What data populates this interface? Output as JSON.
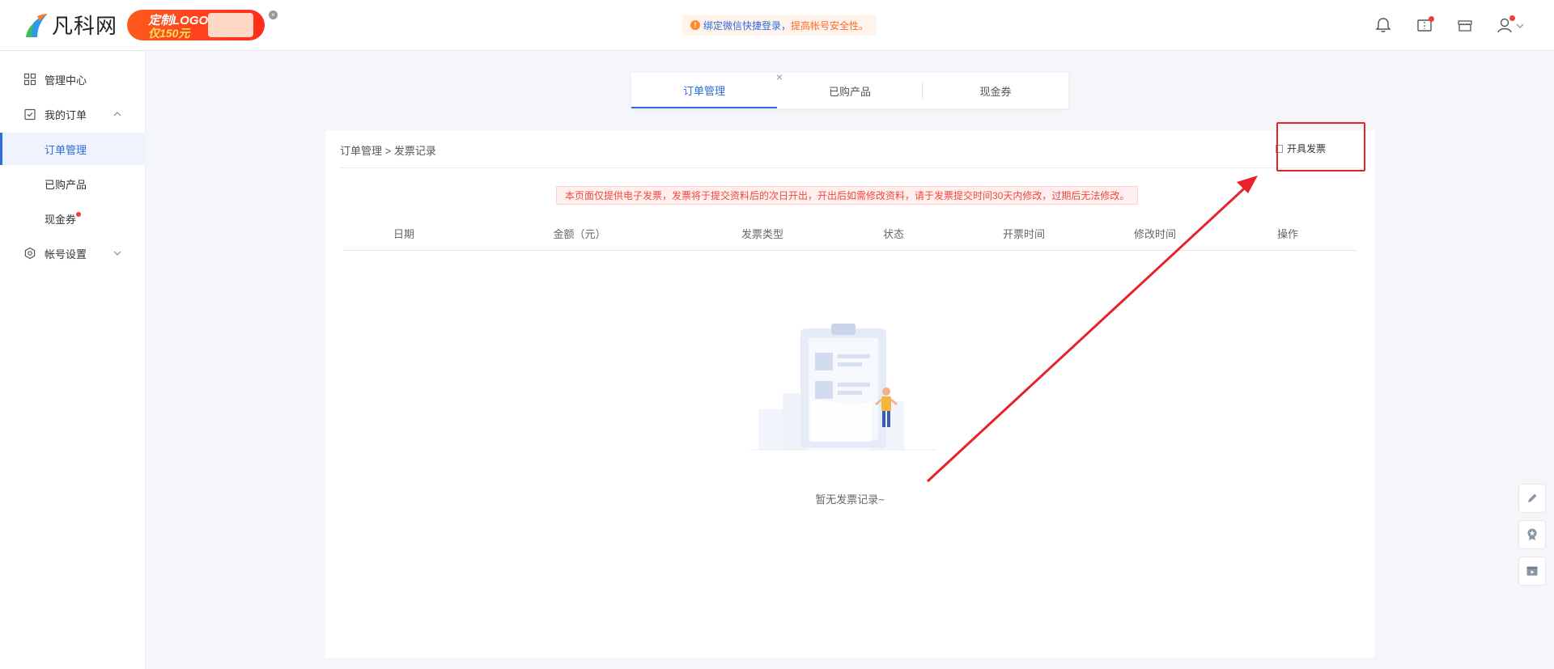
{
  "header": {
    "logo_text": "凡科网",
    "promo": {
      "line1": "定制LOGO",
      "line2": "仅150元"
    },
    "notice": {
      "part1": "绑定微信快捷登录，",
      "part2": "提高帐号安全性。"
    },
    "icons": [
      "bell-icon",
      "ticket-icon",
      "store-icon",
      "user-icon"
    ]
  },
  "sidebar": {
    "items": [
      {
        "label": "管理中心",
        "icon": "grid-icon"
      },
      {
        "label": "我的订单",
        "icon": "clipboard-icon",
        "expanded": true
      },
      {
        "label": "订单管理",
        "active": true
      },
      {
        "label": "已购产品"
      },
      {
        "label": "现金券",
        "badge": true
      },
      {
        "label": "帐号设置",
        "icon": "settings-icon",
        "expanded": false
      }
    ]
  },
  "tabs": [
    {
      "label": "订单管理",
      "active": true
    },
    {
      "label": "已购产品"
    },
    {
      "label": "现金券"
    }
  ],
  "panel": {
    "breadcrumb": "订单管理 > 发票记录",
    "invoice_button": "开具发票",
    "warning": "本页面仅提供电子发票，发票将于提交资料后的次日开出，开出后如需修改资料，请于发票提交时间30天内修改，过期后无法修改。",
    "columns": [
      "日期",
      "金额（元）",
      "发票类型",
      "状态",
      "开票时间",
      "修改时间",
      "操作"
    ],
    "rows": [],
    "empty_text": "暂无发票记录~"
  },
  "colors": {
    "accent": "#2f6bdb",
    "highlight_red": "#e8222a",
    "warning_text": "#f0483e"
  },
  "floating_tools": [
    "pencil-icon",
    "badge-icon",
    "play-icon"
  ]
}
